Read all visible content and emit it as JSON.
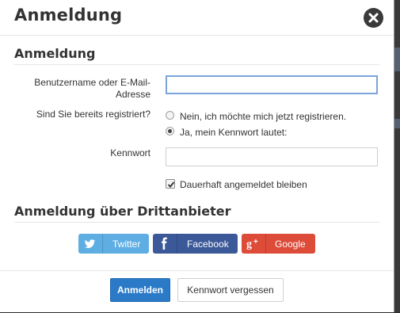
{
  "dialog": {
    "title": "Anmeldung",
    "close_icon": "close-icon"
  },
  "login_section": {
    "title": "Anmeldung",
    "username_label_line1": "Benutzername oder E-Mail-",
    "username_label_line2": "Adresse",
    "username_value": "",
    "registered_label": "Sind Sie bereits registriert?",
    "option_no": "Nein, ich möchte mich jetzt registrieren.",
    "option_yes": "Ja, mein Kennwort lautet:",
    "selected_option": "yes",
    "password_label": "Kennwort",
    "password_value": "",
    "remember_label": "Dauerhaft angemeldet bleiben",
    "remember_checked": true
  },
  "third_party": {
    "title": "Anmeldung über Drittanbieter",
    "buttons": [
      {
        "label": "Twitter",
        "icon": "twitter-icon",
        "color": "#5eaee3"
      },
      {
        "label": "Facebook",
        "icon": "facebook-icon",
        "color": "#3b5998"
      },
      {
        "label": "Google",
        "icon": "google-plus-icon",
        "color": "#dd4b39"
      }
    ]
  },
  "footer": {
    "login_button": "Anmelden",
    "forgot_button": "Kennwort vergessen"
  },
  "colors": {
    "primary": "#2a7ac7",
    "focus_border": "#7ba4d8"
  }
}
